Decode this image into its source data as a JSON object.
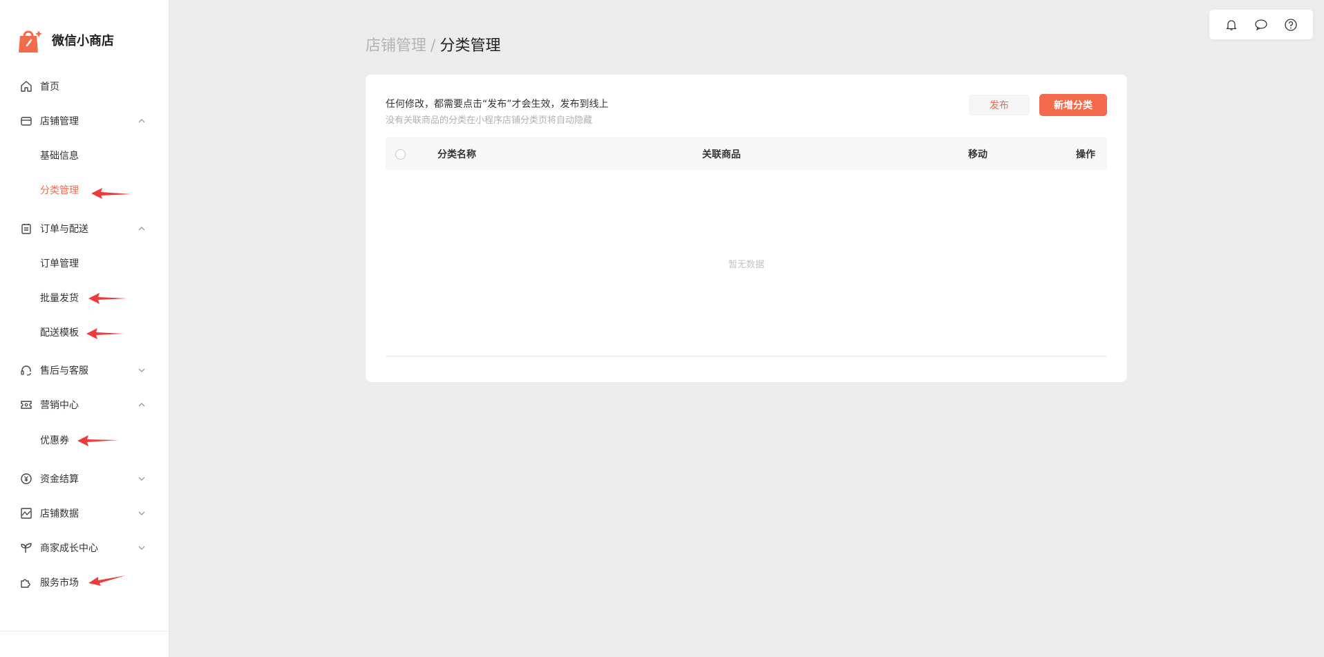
{
  "brand": {
    "name": "微信小商店",
    "accent": "#f36a4c"
  },
  "sidebar": {
    "items": [
      {
        "label": "首页",
        "icon": "home-icon"
      },
      {
        "label": "店铺管理",
        "icon": "store-icon"
      },
      {
        "label": "基础信息"
      },
      {
        "label": "分类管理",
        "active": true
      },
      {
        "label": "订单与配送",
        "icon": "order-clipboard-icon"
      },
      {
        "label": "订单管理"
      },
      {
        "label": "批量发货"
      },
      {
        "label": "配送模板"
      },
      {
        "label": "售后与客服",
        "icon": "headset-icon"
      },
      {
        "label": "营销中心",
        "icon": "ticket-icon"
      },
      {
        "label": "优惠券"
      },
      {
        "label": "资金结算",
        "icon": "yuan-icon"
      },
      {
        "label": "店铺数据",
        "icon": "chart-icon"
      },
      {
        "label": "商家成长中心",
        "icon": "sprout-icon"
      },
      {
        "label": "服务市场",
        "icon": "puzzle-icon"
      }
    ]
  },
  "toolbar": {
    "icons": [
      "bell-icon",
      "message-icon",
      "help-icon"
    ]
  },
  "breadcrumb": {
    "parent": "店铺管理",
    "separator": "/",
    "current": "分类管理"
  },
  "main": {
    "notice": "任何修改，都需要点击“发布”才会生效，发布到线上",
    "subnotice": "没有关联商品的分类在小程序店铺分类页将自动隐藏",
    "publish_label": "发布",
    "add_label": "新增分类",
    "columns": [
      "分类名称",
      "关联商品",
      "移动",
      "操作"
    ],
    "empty_text": "暂无数据"
  }
}
